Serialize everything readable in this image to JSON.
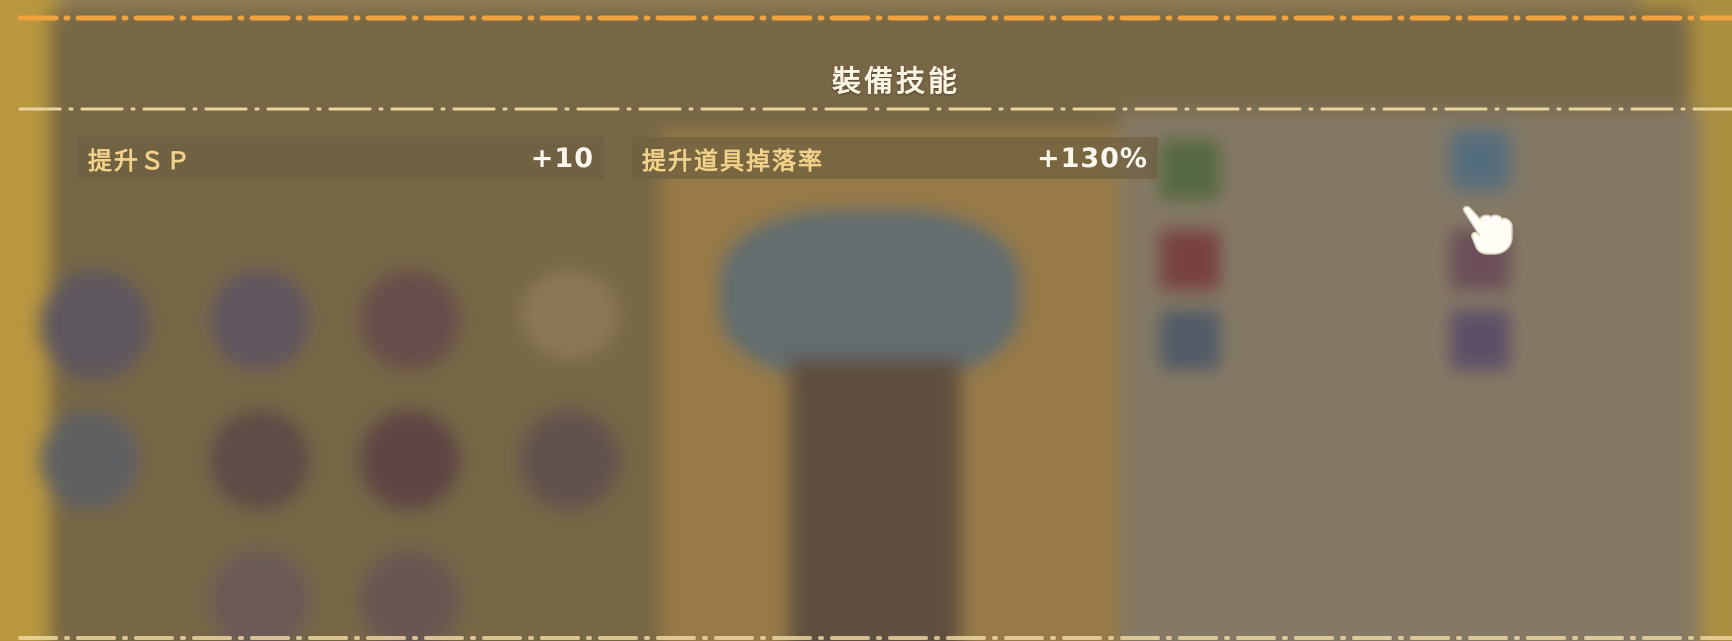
{
  "panel": {
    "title": "裝備技能"
  },
  "skills": [
    {
      "name": "提升ＳＰ",
      "value": "+10"
    },
    {
      "name": "提升道具掉落率",
      "value": "+130%"
    }
  ],
  "cursor": {
    "icon": "pointing-hand-icon"
  },
  "colors": {
    "dash_top": "#f0a23c",
    "dash_under_title": "#e8d49c",
    "skill_name": "#f2d28a",
    "skill_value": "#fbf7ee",
    "title": "#fbf4e2"
  }
}
